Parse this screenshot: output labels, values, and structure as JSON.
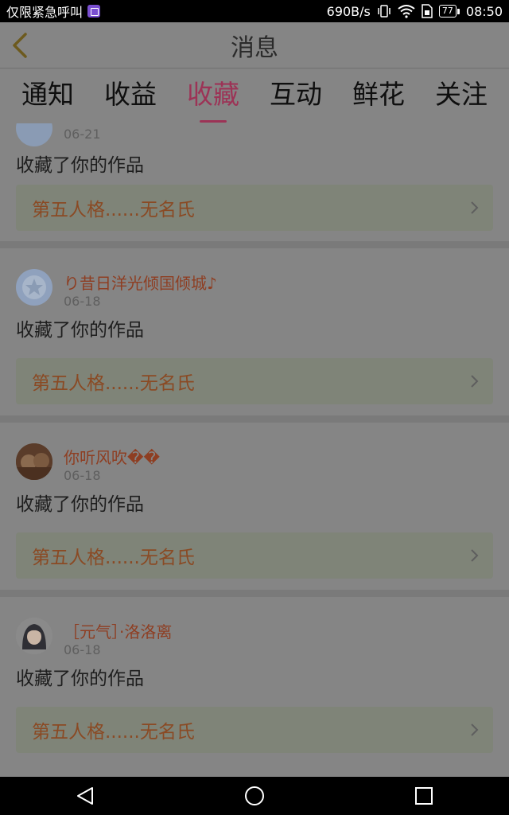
{
  "status_bar": {
    "carrier": "仅限紧急呼叫",
    "speed": "690B/s",
    "battery": "77",
    "time": "08:50"
  },
  "header": {
    "title": "消息"
  },
  "tabs": [
    {
      "label": "通知"
    },
    {
      "label": "收益"
    },
    {
      "label": "收藏"
    },
    {
      "label": "互动"
    },
    {
      "label": "鲜花"
    },
    {
      "label": "关注"
    }
  ],
  "active_tab": "收藏",
  "messages": [
    {
      "username": "",
      "date": "06-21",
      "action": "收藏了你的作品",
      "work_title": "第五人格......无名氏"
    },
    {
      "username": "り昔日洋光倾国倾城♪",
      "date": "06-18",
      "action": "收藏了你的作品",
      "work_title": "第五人格......无名氏"
    },
    {
      "username": "你听风吹��",
      "date": "06-18",
      "action": "收藏了你的作品",
      "work_title": "第五人格......无名氏"
    },
    {
      "username": "［元气］·洛洛离",
      "date": "06-18",
      "action": "收藏了你的作品",
      "work_title": "第五人格......无名氏"
    }
  ],
  "colors": {
    "accent": "#9c3356",
    "username": "#8e3e22",
    "overlay_bg": "#858585"
  }
}
